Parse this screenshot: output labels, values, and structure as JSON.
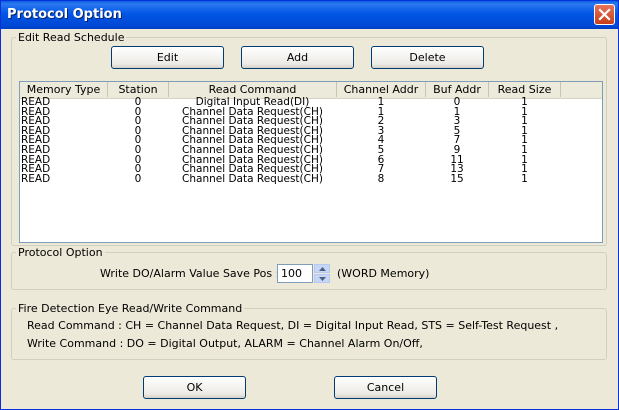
{
  "window": {
    "title": "Protocol Option"
  },
  "schedule": {
    "legend": "Edit Read Schedule",
    "edit_label": "Edit",
    "add_label": "Add",
    "delete_label": "Delete",
    "columns": [
      "Memory Type",
      "Station",
      "Read Command",
      "Channel Addr",
      "Buf Addr",
      "Read Size"
    ],
    "rows": [
      [
        "READ",
        "0",
        "Digital Input Read(DI)",
        "1",
        "0",
        "1"
      ],
      [
        "READ",
        "0",
        "Channel Data Request(CH)",
        "1",
        "1",
        "1"
      ],
      [
        "READ",
        "0",
        "Channel Data Request(CH)",
        "2",
        "3",
        "1"
      ],
      [
        "READ",
        "0",
        "Channel Data Request(CH)",
        "3",
        "5",
        "1"
      ],
      [
        "READ",
        "0",
        "Channel Data Request(CH)",
        "4",
        "7",
        "1"
      ],
      [
        "READ",
        "0",
        "Channel Data Request(CH)",
        "5",
        "9",
        "1"
      ],
      [
        "READ",
        "0",
        "Channel Data Request(CH)",
        "6",
        "11",
        "1"
      ],
      [
        "READ",
        "0",
        "Channel Data Request(CH)",
        "7",
        "13",
        "1"
      ],
      [
        "READ",
        "0",
        "Channel Data Request(CH)",
        "8",
        "15",
        "1"
      ]
    ]
  },
  "protocol": {
    "legend": "Protocol Option",
    "save_pos_label": "Write DO/Alarm Value Save Pos :",
    "save_pos_value": "100",
    "unit_label": "(WORD Memory)"
  },
  "fire": {
    "legend": "Fire Detection Eye Read/Write Command",
    "read_line": "Read Command : CH = Channel Data Request, DI = Digital Input Read, STS = Self-Test Request ,",
    "write_line": "Write Command : DO = Digital Output, ALARM = Channel Alarm On/Off,"
  },
  "footer": {
    "ok_label": "OK",
    "cancel_label": "Cancel"
  }
}
